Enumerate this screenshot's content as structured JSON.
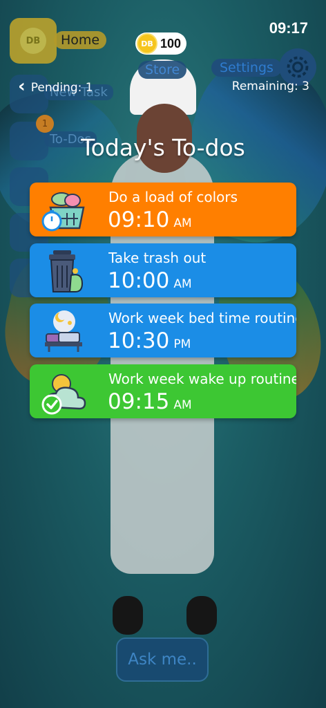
{
  "status_bar": {
    "time": "09:17"
  },
  "header": {
    "coin_icon_label": "DB",
    "coin_count": "100",
    "back_label": "Pending: 1",
    "remaining_label": "Remaining: 3"
  },
  "background_menu": {
    "avatar_label": "DB",
    "home_label": "Home",
    "store_label": "Store",
    "settings_label": "Settings",
    "new_task_label": "New Task",
    "todos_label": "To-Dos",
    "todos_badge": "1"
  },
  "main": {
    "title": "Today's To-dos",
    "todos": [
      {
        "name": "Do a load of colors",
        "time": "09:10",
        "ampm": "AM",
        "color": "#ff7f00",
        "icon": "laundry-timer-icon"
      },
      {
        "name": "Take trash out",
        "time": "10:00",
        "ampm": "AM",
        "color": "#1b8de6",
        "icon": "trash-can-icon"
      },
      {
        "name": "Work week bed time routine",
        "time": "10:30",
        "ampm": "PM",
        "color": "#1b8de6",
        "icon": "bed-moon-icon"
      },
      {
        "name": "Work week wake up routine",
        "time": "09:15",
        "ampm": "AM",
        "color": "#3dc733",
        "icon": "sun-cloud-check-icon"
      }
    ]
  },
  "footer": {
    "ask_label": "Ask me.."
  }
}
